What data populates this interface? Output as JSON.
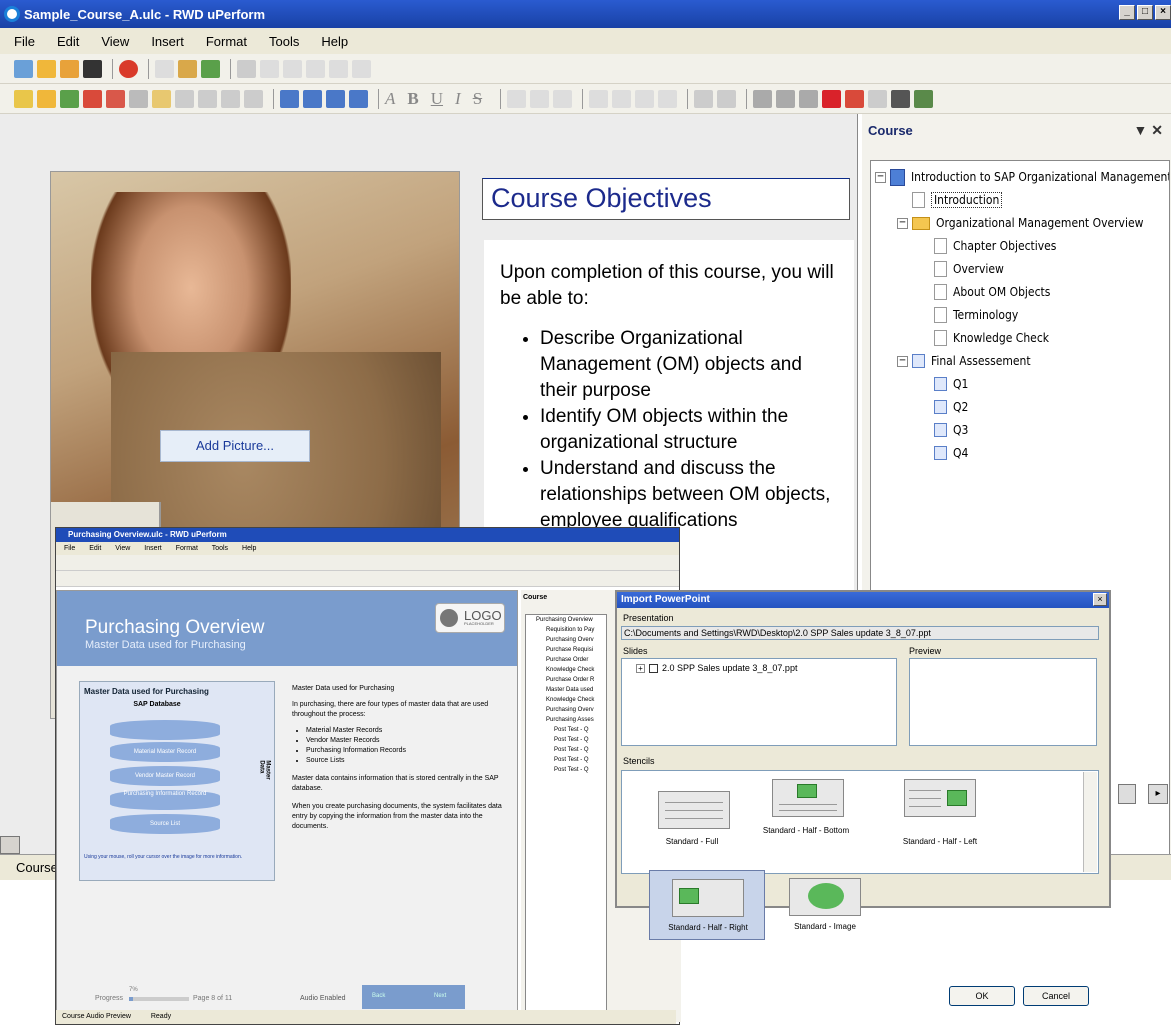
{
  "app": {
    "title": "Sample_Course_A.ulc - RWD uPerform",
    "window_buttons": [
      "_",
      "□",
      "×"
    ]
  },
  "menu": [
    "File",
    "Edit",
    "View",
    "Insert",
    "Format",
    "Tools",
    "Help"
  ],
  "format_toolbar": [
    "A",
    "B",
    "U",
    "I",
    "S"
  ],
  "slide": {
    "add_picture": "Add Picture...",
    "title": "Course Objectives",
    "intro": "Upon completion of this course, you will be able to:",
    "bullets": [
      "Describe Organizational Management (OM) objects and their purpose",
      "Identify OM objects within the organizational structure",
      "Understand and discuss the relationships between OM objects, employee qualifications"
    ]
  },
  "course_panel": {
    "title": "Course",
    "tree": [
      {
        "label": "Introduction to SAP Organizational Management",
        "icon": "book-icon",
        "level": 0,
        "toggle": "−"
      },
      {
        "label": "Introduction",
        "icon": "page-icon",
        "level": 1,
        "selected": true
      },
      {
        "label": "Organizational Management Overview",
        "icon": "folder-icon",
        "level": 1,
        "toggle": "−"
      },
      {
        "label": "Chapter Objectives",
        "icon": "page-icon",
        "level": 2
      },
      {
        "label": "Overview",
        "icon": "page-icon",
        "level": 2
      },
      {
        "label": "About OM Objects",
        "icon": "page-icon",
        "level": 2
      },
      {
        "label": "Terminology",
        "icon": "page-icon",
        "level": 2
      },
      {
        "label": "Knowledge Check",
        "icon": "page-icon",
        "level": 2
      },
      {
        "label": "Final Assessement",
        "icon": "quiz-icon",
        "level": 1,
        "toggle": "−"
      },
      {
        "label": "Q1",
        "icon": "quiz-icon",
        "level": 2
      },
      {
        "label": "Q2",
        "icon": "quiz-icon",
        "level": 2
      },
      {
        "label": "Q3",
        "icon": "quiz-icon",
        "level": 2
      },
      {
        "label": "Q4",
        "icon": "quiz-icon",
        "level": 2
      }
    ]
  },
  "status": {
    "tab": "Course"
  },
  "inner_window": {
    "title": "Purchasing Overview.ulc - RWD uPerform",
    "menu": [
      "File",
      "Edit",
      "View",
      "Insert",
      "Format",
      "Tools",
      "Help"
    ],
    "slide_title": "Purchasing Overview",
    "slide_subtitle": "Master Data used for Purchasing",
    "logo": "LOGO",
    "logo_sub": "PLACEHOLDER",
    "box_title": "Master Data used for Purchasing",
    "db_title": "SAP Database",
    "db_records": [
      "Material Master Record",
      "Vendor Master Record",
      "Purchasing Information Record",
      "Source List"
    ],
    "master_data_label": "Master Data",
    "box_note": "Using your mouse, roll your cursor over the image for more information.",
    "text_heading": "Master Data used for Purchasing",
    "text_p1": "In purchasing, there are four types of master data that are used throughout the process:",
    "text_bullets": [
      "Material Master Records",
      "Vendor Master Records",
      "Purchasing Information Records",
      "Source Lists"
    ],
    "text_p2": "Master data contains information that is stored centrally in the SAP database.",
    "text_p3": "When you create purchasing documents, the system facilitates data entry by copying the information from the master data into the documents.",
    "progress_label": "Progress",
    "progress_value": "7%",
    "progress_fraction": 0.07,
    "page_label": "Page 8 of 11",
    "audio": "Audio Enabled",
    "back": "Back",
    "next": "Next",
    "panel_title": "Course",
    "tree": [
      "Purchasing Overview",
      "Requisition to Pay",
      "Purchasing Overv",
      "Purchase Requisi",
      "Purchase Order",
      "Knowledge Check",
      "Purchase Order R",
      "Master Data used",
      "Knowledge Check",
      "Purchasing Overv",
      "Purchasing Asses",
      "Post Test - Q",
      "Post Test - Q",
      "Post Test - Q",
      "Post Test - Q",
      "Post Test - Q"
    ],
    "status": [
      "Course",
      "Audio",
      "Preview",
      "Ready"
    ]
  },
  "dialog": {
    "title": "Import PowerPoint",
    "presentation_label": "Presentation",
    "path": "C:\\Documents and Settings\\RWD\\Desktop\\2.0 SPP Sales update 3_8_07.ppt",
    "slides_label": "Slides",
    "preview_label": "Preview",
    "slides_item": "2.0 SPP Sales update 3_8_07.ppt",
    "stencils_label": "Stencils",
    "stencils": [
      "Standard - Full",
      "Standard - Half - Bottom",
      "Standard - Half - Left",
      "Standard - Half - Right",
      "Standard - Image"
    ],
    "ok": "OK",
    "cancel": "Cancel"
  }
}
